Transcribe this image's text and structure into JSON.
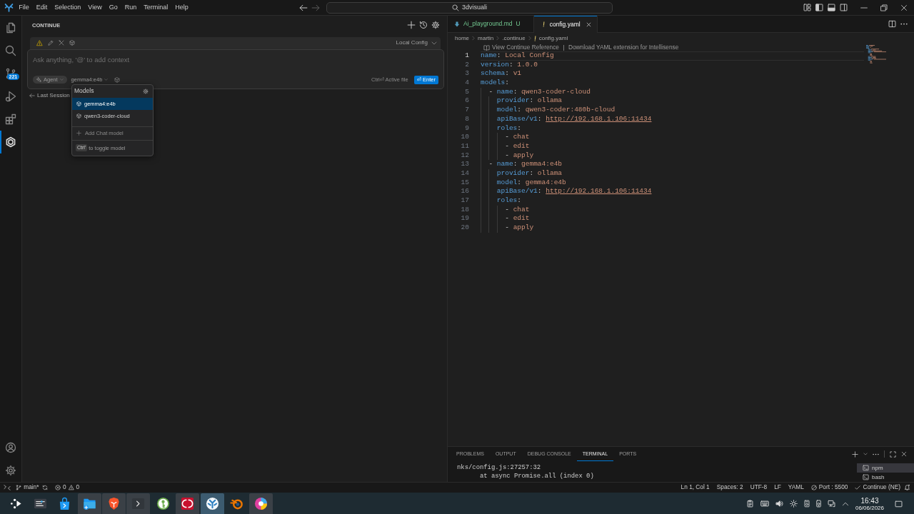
{
  "title_bar": {
    "menu": [
      "File",
      "Edit",
      "Selection",
      "View",
      "Go",
      "Run",
      "Terminal",
      "Help"
    ],
    "navigation": [
      {
        "disabled": false
      },
      {
        "disabled": true
      }
    ],
    "command_center": "3dvisuali"
  },
  "activity_bar": {
    "items": [
      {
        "selected": false
      },
      {
        "selected": false
      },
      {
        "selected": false,
        "badge": "221"
      },
      {
        "selected": false
      },
      {
        "selected": false
      },
      {
        "selected": true
      }
    ]
  },
  "sidebar": {
    "title": "CONTINUE",
    "composer": {
      "config": "Local Config",
      "placeholder": "Ask anything, '@' to add context",
      "mode": "Agent",
      "model": "gemma4:e4b",
      "hint": "Ctrl⏎ Active file",
      "submit": "⏎ Enter"
    },
    "back_link": "Last Session",
    "model_menu": {
      "title": "Models",
      "items": [
        {
          "label": "gemma4:e4b",
          "selected": true
        },
        {
          "label": "qwen3-coder-cloud",
          "selected": false
        }
      ],
      "add": "Add Chat model",
      "shortcut_key": "Ctrl'",
      "shortcut_hint": "to toggle model"
    }
  },
  "editor": {
    "tabs": [
      {
        "label": "Ai_playground.md",
        "status": "U",
        "kind": "markdown",
        "selected": false
      },
      {
        "label": "config.yaml",
        "kind": "yaml",
        "selected": true
      }
    ],
    "breadcrumb": [
      {
        "label": "home",
        "kind": "folder"
      },
      {
        "label": "martin",
        "kind": "folder"
      },
      {
        "label": ".continue",
        "kind": "folder"
      },
      {
        "label": "config.yaml",
        "kind": "yaml"
      }
    ],
    "codelens": [
      "View Continue Reference",
      "Download YAML extension for Intellisense"
    ],
    "lines": [
      {
        "number": "1",
        "text": "name: Local Config",
        "current": true,
        "link": false
      },
      {
        "number": "2",
        "text": "version: 1.0.0",
        "current": false,
        "link": false
      },
      {
        "number": "3",
        "text": "schema: v1",
        "current": false,
        "link": false
      },
      {
        "number": "4",
        "text": "models:",
        "current": false,
        "link": false
      },
      {
        "number": "5",
        "text": "  - name: qwen3-coder-cloud",
        "current": false,
        "link": false
      },
      {
        "number": "6",
        "text": "    provider: ollama",
        "current": false,
        "link": false
      },
      {
        "number": "7",
        "text": "    model: qwen3-coder:480b-cloud",
        "current": false,
        "link": false
      },
      {
        "number": "8",
        "text": "    apiBase/v1: http://192.168.1.106:11434",
        "current": false,
        "link": true
      },
      {
        "number": "9",
        "text": "    roles:",
        "current": false,
        "link": false
      },
      {
        "number": "10",
        "text": "      - chat",
        "current": false,
        "link": false
      },
      {
        "number": "11",
        "text": "      - edit",
        "current": false,
        "link": false
      },
      {
        "number": "12",
        "text": "      - apply",
        "current": false,
        "link": false
      },
      {
        "number": "13",
        "text": "  - name: gemma4:e4b",
        "current": false,
        "link": false
      },
      {
        "number": "14",
        "text": "    provider: ollama",
        "current": false,
        "link": false
      },
      {
        "number": "15",
        "text": "    model: gemma4:e4b",
        "current": false,
        "link": false
      },
      {
        "number": "16",
        "text": "    apiBase/v1: http://192.168.1.106:11434",
        "current": false,
        "link": true
      },
      {
        "number": "17",
        "text": "    roles:",
        "current": false,
        "link": false
      },
      {
        "number": "18",
        "text": "      - chat",
        "current": false,
        "link": false
      },
      {
        "number": "19",
        "text": "      - edit",
        "current": false,
        "link": false
      },
      {
        "number": "20",
        "text": "      - apply",
        "current": false,
        "link": false
      }
    ]
  },
  "panel": {
    "tabs": [
      {
        "label": "PROBLEMS",
        "selected": false
      },
      {
        "label": "OUTPUT",
        "selected": false
      },
      {
        "label": "DEBUG CONSOLE",
        "selected": false
      },
      {
        "label": "TERMINAL",
        "selected": true
      },
      {
        "label": "PORTS",
        "selected": false
      }
    ],
    "terminal_lines": [
      "nks/config.js:27257:32",
      "      at async Promise.all (index 0)"
    ],
    "terminals": [
      {
        "label": "npm",
        "selected": true
      },
      {
        "label": "bash",
        "selected": false
      }
    ]
  },
  "status_bar": {
    "branch": "main*",
    "problems": [
      {
        "kind": "error",
        "count": "0"
      },
      {
        "kind": "warning",
        "count": "0"
      }
    ],
    "items": [
      {
        "label": "Ln 1, Col 1",
        "kind": "text"
      },
      {
        "label": "Spaces: 2",
        "kind": "text"
      },
      {
        "label": "UTF-8",
        "kind": "text"
      },
      {
        "label": "LF",
        "kind": "text"
      },
      {
        "label": "YAML",
        "kind": "text"
      },
      {
        "label": "Port : 5500",
        "kind": "server"
      },
      {
        "label": "Continue (NE)",
        "kind": "extension"
      }
    ]
  },
  "taskbar": {
    "apps": [
      {
        "open": false,
        "selected": false
      },
      {
        "open": false,
        "selected": false
      },
      {
        "open": false,
        "selected": false
      },
      {
        "open": true,
        "selected": false
      },
      {
        "open": true,
        "selected": false
      },
      {
        "open": true,
        "selected": false
      },
      {
        "open": false,
        "selected": false
      },
      {
        "open": true,
        "selected": false
      },
      {
        "open": true,
        "selected": true
      },
      {
        "open": false,
        "selected": false
      },
      {
        "open": true,
        "selected": false
      }
    ],
    "clock": {
      "time": "16:43",
      "date": "06/06/2026"
    }
  }
}
